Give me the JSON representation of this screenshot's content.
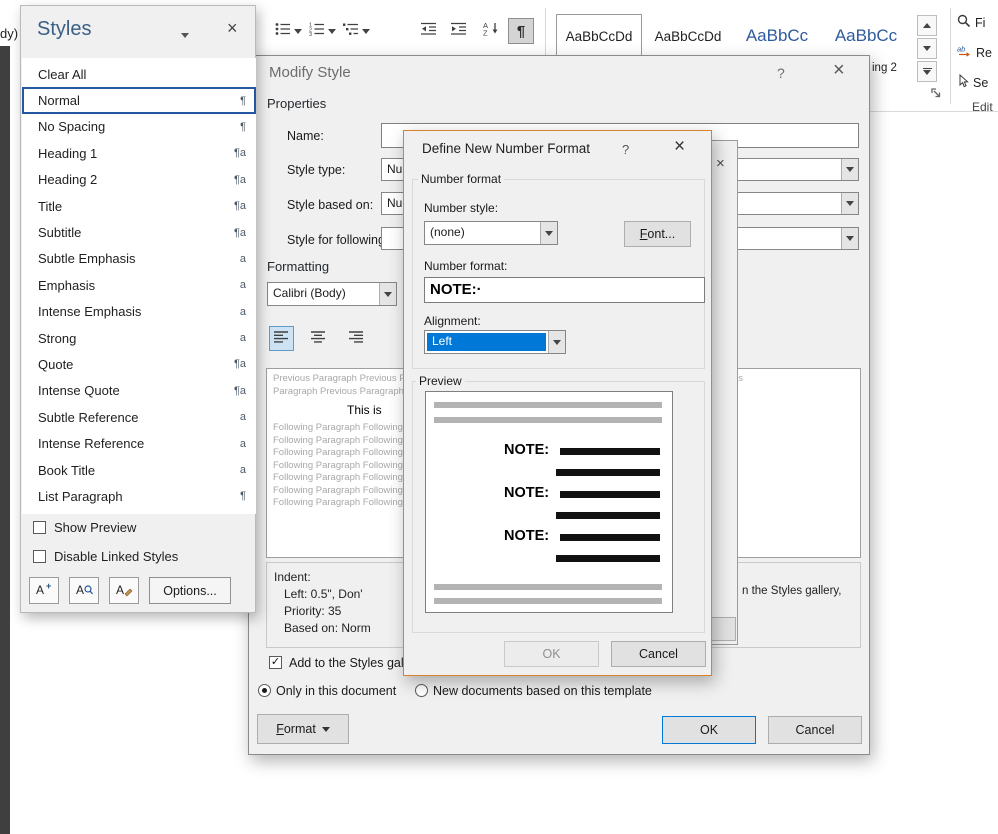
{
  "window": {
    "left_fragment": "dy)"
  },
  "styles_pane": {
    "title": "Styles",
    "close": "×",
    "items": [
      {
        "label": "Clear All",
        "marker": ""
      },
      {
        "label": "Normal",
        "marker": "¶"
      },
      {
        "label": "No Spacing",
        "marker": "¶"
      },
      {
        "label": "Heading 1",
        "marker": "¶a"
      },
      {
        "label": "Heading 2",
        "marker": "¶a"
      },
      {
        "label": "Title",
        "marker": "¶a"
      },
      {
        "label": "Subtitle",
        "marker": "¶a"
      },
      {
        "label": "Subtle Emphasis",
        "marker": "a"
      },
      {
        "label": "Emphasis",
        "marker": "a"
      },
      {
        "label": "Intense Emphasis",
        "marker": "a"
      },
      {
        "label": "Strong",
        "marker": "a"
      },
      {
        "label": "Quote",
        "marker": "¶a"
      },
      {
        "label": "Intense Quote",
        "marker": "¶a"
      },
      {
        "label": "Subtle Reference",
        "marker": "a"
      },
      {
        "label": "Intense Reference",
        "marker": "a"
      },
      {
        "label": "Book Title",
        "marker": "a"
      },
      {
        "label": "List Paragraph",
        "marker": "¶"
      }
    ],
    "show_preview": "Show Preview",
    "disable_linked": "Disable Linked Styles",
    "options": "Options..."
  },
  "ribbon": {
    "pilcrow": "¶",
    "gallery": [
      {
        "preview": "AaBbCcDd"
      },
      {
        "preview": "AaBbCcDd"
      },
      {
        "preview": "AaBbCc"
      },
      {
        "preview": "AaBbCc"
      }
    ],
    "gallery_label_fragment": "ing 2",
    "editing": {
      "find": "Fi",
      "replace": "Re",
      "select": "Se",
      "group": "Edit"
    }
  },
  "modify_dialog": {
    "title": "Modify Style",
    "help": "?",
    "close": "×",
    "properties": "Properties",
    "name_label": "Name:",
    "style_type_label": "Style type:",
    "style_type_fragment": "Nu",
    "style_based_label": "Style based on:",
    "style_based_fragment": "Nu",
    "style_following_label": "Style for following p",
    "formatting": "Formatting",
    "font_name": "Calibri (Body)",
    "preview": {
      "previous_line1": "Previous Paragraph Previous Paragraph Previous Paragraph Previous Paragraph Previous Paragraph Previous",
      "previous_line2": "Paragraph Previous Paragraph Previous Paragraph Previous",
      "sample_fragment": "This is ",
      "following_line": "Following Paragraph Following Paragraph Following Paragraph Following Paragraph Following Paragraph"
    },
    "description": {
      "l1": "Indent:",
      "l2": "Left:  0.5\", Don'",
      "l3": "Priority: 35",
      "l4": "Based on: Norm",
      "right_fragment": "n the Styles gallery,"
    },
    "add_gallery": "Add to the Styles galle",
    "radio_this_doc": "Only in this document",
    "radio_new_docs": "New documents based on this template",
    "format_btn": "Format",
    "ok": "OK",
    "cancel": "Cancel"
  },
  "numbering_dialog": {
    "close": "×"
  },
  "define_dialog": {
    "title": "Define New Number Format",
    "help": "?",
    "close": "×",
    "number_format_group": "Number format",
    "number_style_label": "Number style:",
    "number_style_value": "(none)",
    "font_btn": "Font...",
    "number_format_label": "Number format:",
    "number_format_value": "NOTE:·",
    "alignment_label": "Alignment:",
    "alignment_value": "Left",
    "preview_group": "Preview",
    "note_label": "NOTE:",
    "ok": "OK",
    "cancel": "Cancel"
  }
}
